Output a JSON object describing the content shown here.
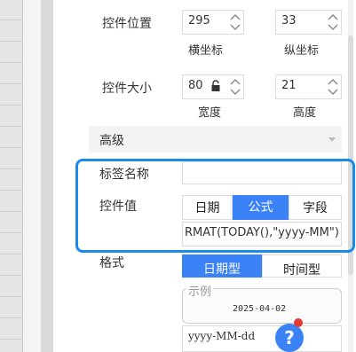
{
  "position": {
    "label": "控件位置",
    "x_value": "295",
    "y_value": "33",
    "x_caption": "横坐标",
    "y_caption": "纵坐标"
  },
  "size": {
    "label": "控件大小",
    "width_value": "80",
    "height_value": "21",
    "width_caption": "宽度",
    "height_caption": "高度"
  },
  "advanced": {
    "label": "高级"
  },
  "tag_name": {
    "label": "标签名称",
    "value": ""
  },
  "control_value": {
    "label": "控件值",
    "tabs": [
      "日期",
      "公式",
      "字段"
    ],
    "active_tab": "公式",
    "formula": "RMAT(TODAY(),\"yyyy-MM\")"
  },
  "format": {
    "label": "格式",
    "types": [
      "日期型",
      "时间型"
    ],
    "example_legend": "示例",
    "example_value": "2025-04-02",
    "pattern_value": "yyyy-MM-dd"
  },
  "help": {
    "icon_label": "?"
  },
  "colors": {
    "accent": "#3b82f6",
    "highlight": "#1a8ce8"
  }
}
